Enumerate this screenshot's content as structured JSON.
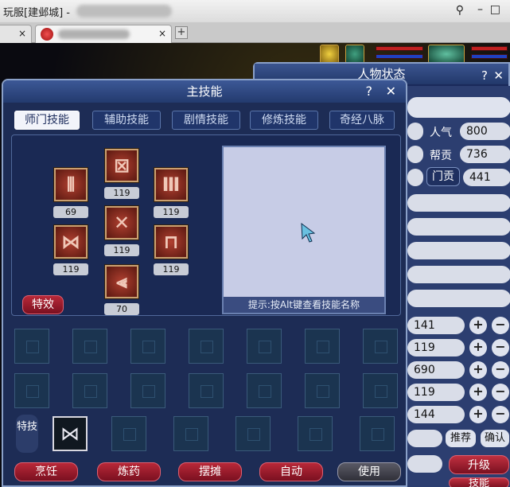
{
  "browser": {
    "window_title": "玩服[建邺城] -",
    "tab_close": "×",
    "new_tab": "+"
  },
  "status_panel": {
    "title": "人物状态",
    "help": "?",
    "close": "✕",
    "stats": [
      {
        "label": "人气",
        "value": "800"
      },
      {
        "label": "帮贡",
        "value": "736"
      },
      {
        "label": "门贡",
        "value": "441"
      }
    ],
    "attributes": [
      "141",
      "119",
      "690",
      "119",
      "144"
    ],
    "plus": "+",
    "minus": "−",
    "recommend": "推荐",
    "confirm": "确认",
    "upgrade": "升级",
    "skills": "技能"
  },
  "skill_panel": {
    "title": "主技能",
    "help": "?",
    "close": "✕",
    "tabs": [
      {
        "label": "师门技能",
        "active": true
      },
      {
        "label": "辅助技能",
        "active": false
      },
      {
        "label": "剧情技能",
        "active": false
      },
      {
        "label": "修炼技能",
        "active": false
      },
      {
        "label": "奇经八脉",
        "active": false
      }
    ],
    "skills": [
      {
        "icon": "skill-rune-1-icon",
        "glyph": "⊠",
        "level": "119"
      },
      {
        "icon": "skill-rune-2-icon",
        "glyph": "⫴",
        "level": "69"
      },
      {
        "icon": "skill-rune-3-icon",
        "glyph": "Ⅲ",
        "level": "119"
      },
      {
        "icon": "skill-rune-4-icon",
        "glyph": "✕",
        "level": "119"
      },
      {
        "icon": "skill-rune-5-icon",
        "glyph": "⋈",
        "level": "119"
      },
      {
        "icon": "skill-rune-6-icon",
        "glyph": "⊓",
        "level": "119"
      },
      {
        "icon": "skill-rune-7-icon",
        "glyph": "⫷",
        "level": "70"
      }
    ],
    "effect_button": "特效",
    "hint": "提示:按Alt键查看技能名称",
    "special_label": "特技",
    "special_icon_glyph": "⋈",
    "bottom_buttons": [
      {
        "label": "烹饪",
        "style": "red"
      },
      {
        "label": "炼药",
        "style": "red"
      },
      {
        "label": "摆摊",
        "style": "red"
      },
      {
        "label": "自动",
        "style": "red"
      },
      {
        "label": "使用",
        "style": "gray"
      }
    ]
  }
}
